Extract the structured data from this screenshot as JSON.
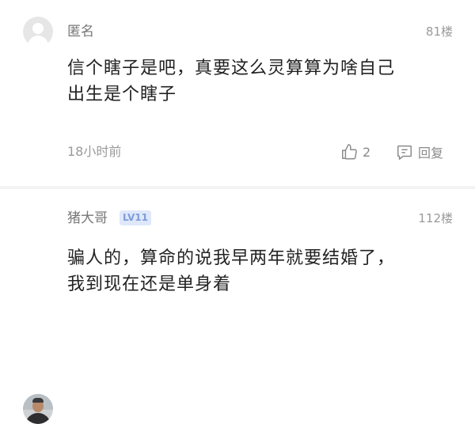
{
  "comments": [
    {
      "username": "匿名",
      "floor": "81楼",
      "content": "信个瞎子是吧，真要这么灵算算为啥自己\n出生是个瞎子",
      "timestamp": "18小时前",
      "likes": "2",
      "reply_label": "回复",
      "avatar": "anonymous-avatar"
    },
    {
      "username": "猪大哥",
      "level": "LV11",
      "floor": "112楼",
      "content": "骗人的，算命的说我早两年就要结婚了，\n我到现在还是单身着",
      "avatar": "user-photo-avatar"
    }
  ],
  "colors": {
    "level_badge_bg": "#dfe8fb",
    "level_badge_text": "#7f9cd9",
    "secondary_text": "#9a9a9a"
  }
}
